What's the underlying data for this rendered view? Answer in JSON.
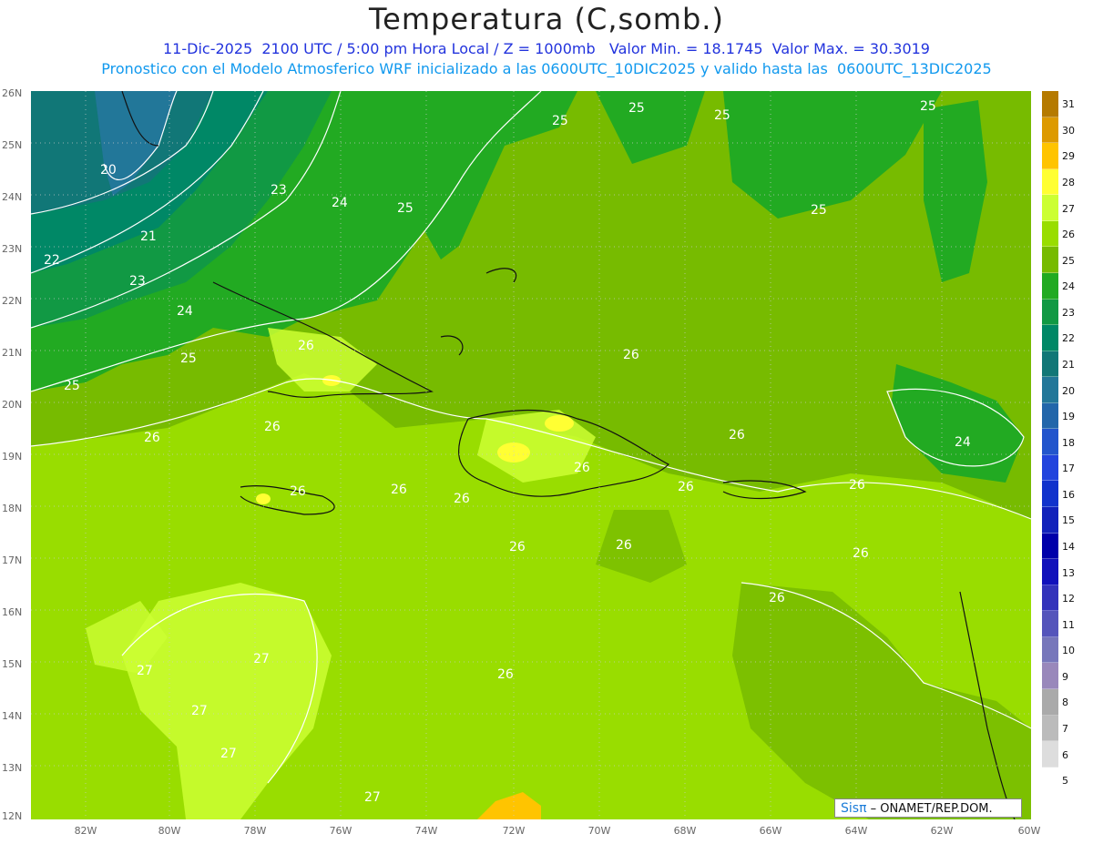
{
  "header": {
    "title": "Temperatura (C,somb.)",
    "subtitle1": "11-Dic-2025  2100 UTC / 5:00 pm Hora Local / Z = 1000mb   Valor Min. = 18.1745  Valor Max. = 30.3019",
    "subtitle2": "Pronostico con el Modelo Atmosferico WRF inicializado a las 0600UTC_10DIC2025 y valido hasta las  0600UTC_13DIC2025"
  },
  "axes": {
    "lat_labels": [
      "26N",
      "25N",
      "24N",
      "23N",
      "22N",
      "21N",
      "20N",
      "19N",
      "18N",
      "17N",
      "16N",
      "15N",
      "14N",
      "13N",
      "12N"
    ],
    "lon_labels": [
      "82W",
      "80W",
      "78W",
      "76W",
      "74W",
      "72W",
      "70W",
      "68W",
      "66W",
      "64W",
      "62W",
      "60W"
    ]
  },
  "colorbar": {
    "labels": [
      "31",
      "30",
      "29",
      "28",
      "27",
      "26",
      "25",
      "24",
      "23",
      "22",
      "21",
      "20",
      "19",
      "18",
      "17",
      "16",
      "15",
      "14",
      "13",
      "12",
      "11",
      "10",
      "9",
      "8",
      "7",
      "6",
      "5"
    ],
    "colors": [
      "#b57a00",
      "#dd9a00",
      "#ffc400",
      "#ffff33",
      "#ccff33",
      "#99dd00",
      "#77bb00",
      "#22aa22",
      "#119944",
      "#008866",
      "#117777",
      "#227799",
      "#2266aa",
      "#2255cc",
      "#2244dd",
      "#1133cc",
      "#1122bb",
      "#0000aa",
      "#1111bb",
      "#3333bb",
      "#5555bb",
      "#7777bb",
      "#9988bb",
      "#aaaaaa",
      "#bbbbbb",
      "#dddddd",
      "#ffffff"
    ]
  },
  "contour_labels": [
    "20",
    "21",
    "22",
    "23",
    "23",
    "24",
    "24",
    "25",
    "25",
    "25",
    "25",
    "25",
    "25",
    "25",
    "26",
    "26",
    "26",
    "26",
    "26",
    "26",
    "26",
    "26",
    "26",
    "26",
    "26",
    "26",
    "26",
    "26",
    "26",
    "26",
    "27",
    "27",
    "27",
    "27",
    "27",
    "24",
    "25"
  ],
  "credit": {
    "logo": "Sisπ",
    "text": "– ONAMET/REP.DOM."
  }
}
